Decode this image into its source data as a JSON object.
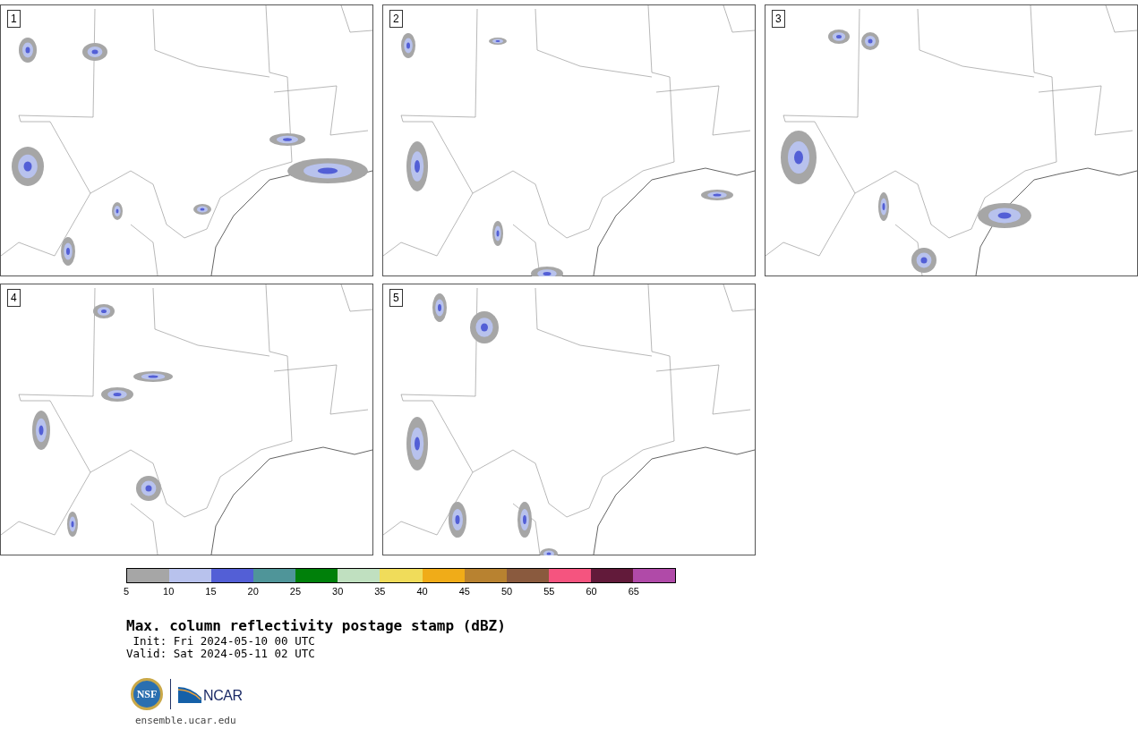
{
  "panels": [
    {
      "label": "1"
    },
    {
      "label": "2"
    },
    {
      "label": "3"
    },
    {
      "label": "4"
    },
    {
      "label": "5"
    }
  ],
  "colorbar": {
    "segments": [
      {
        "color": "#a6a6a6"
      },
      {
        "color": "#b8c2ed"
      },
      {
        "color": "#535fd6"
      },
      {
        "color": "#4f9599"
      },
      {
        "color": "#00800a"
      },
      {
        "color": "#c0e0c0"
      },
      {
        "color": "#f0dc5a"
      },
      {
        "color": "#f0ac18"
      },
      {
        "color": "#b88230"
      },
      {
        "color": "#8a5a3e"
      },
      {
        "color": "#f5547f"
      },
      {
        "color": "#621a3a"
      },
      {
        "color": "#b04aa8"
      }
    ],
    "ticks": [
      "5",
      "10",
      "15",
      "20",
      "25",
      "30",
      "35",
      "40",
      "45",
      "50",
      "55",
      "60",
      "65"
    ]
  },
  "title": "Max. column reflectivity postage stamp (dBZ)",
  "init": " Init: Fri 2024-05-10 00 UTC",
  "valid": "Valid: Sat 2024-05-11 02 UTC",
  "logos": {
    "nsf": "NSF",
    "ncar": "NCAR"
  },
  "footer_link": "ensemble.ucar.edu"
}
